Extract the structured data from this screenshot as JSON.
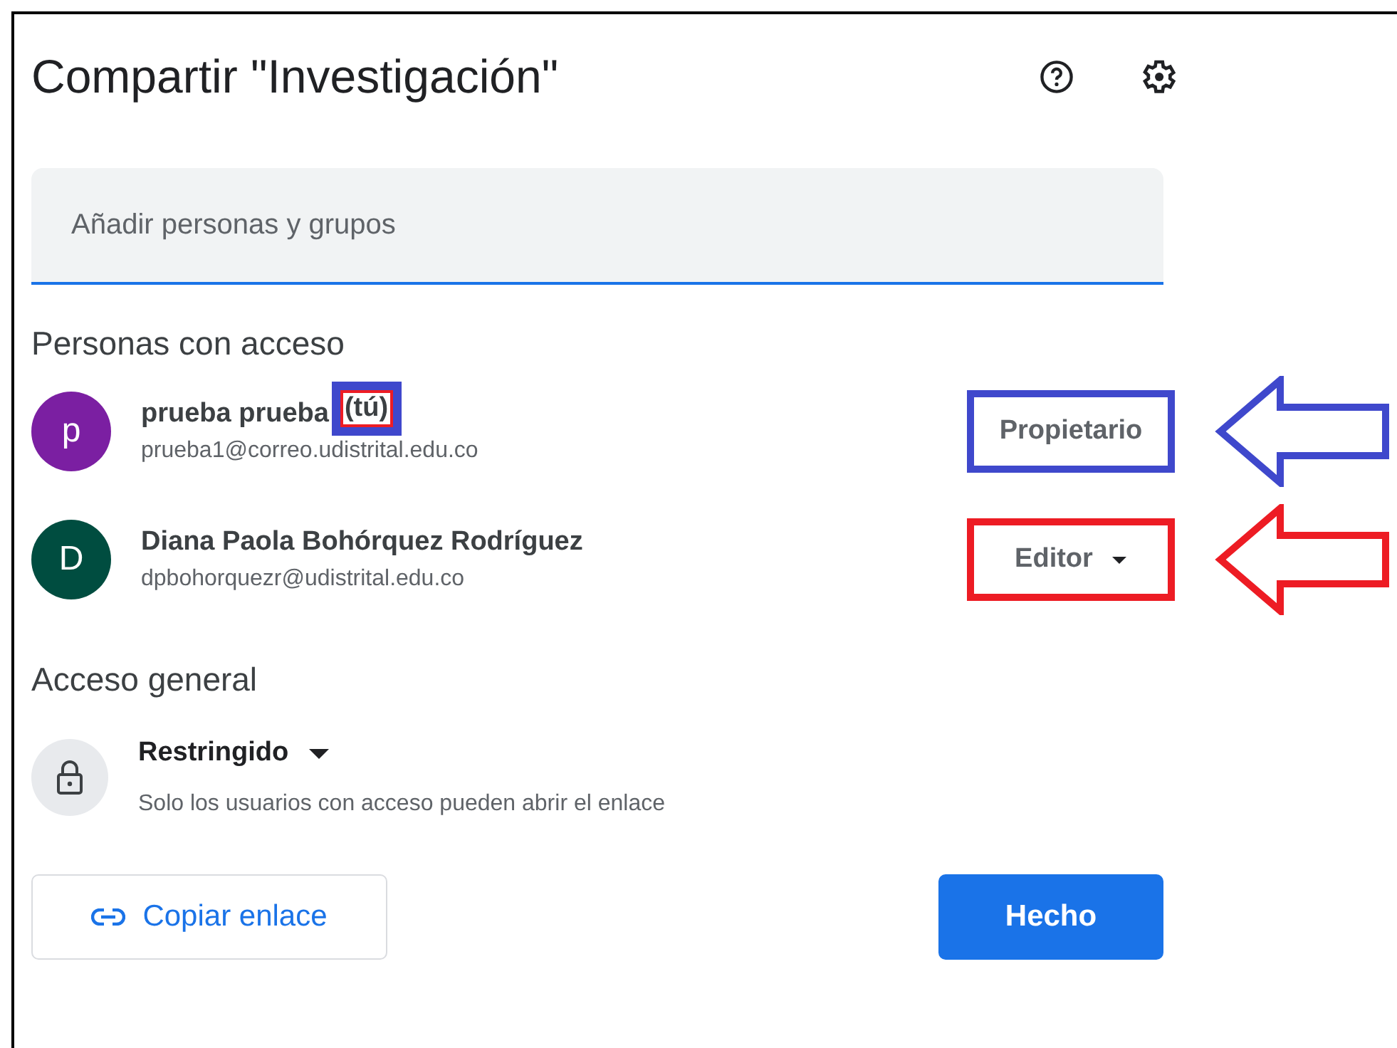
{
  "dialog": {
    "title": "Compartir \"Investigación\"",
    "search": {
      "placeholder": "Añadir personas y grupos"
    },
    "people_heading": "Personas con acceso",
    "people": [
      {
        "initial": "p",
        "color": "#7b1fa2",
        "name": "prueba prueba",
        "you_tag": {
          "text": "(tú)",
          "outlines": [
            {
              "color": "#3f48cc"
            },
            {
              "color": "#ed1c24"
            }
          ]
        },
        "email": "prueba1@correo.udistrital.edu.co",
        "role": "Propietario",
        "role_dropdown": false,
        "annotation": {
          "color": "#3f48cc"
        }
      },
      {
        "initial": "D",
        "color": "#004d40",
        "name": "Diana Paola Bohórquez Rodríguez",
        "email": "dpbohorquezr@udistrital.edu.co",
        "role": "Editor",
        "role_dropdown": true,
        "annotation": {
          "color": "#ed1c24"
        }
      }
    ],
    "general_heading": "Acceso general",
    "general": {
      "access": "Restringido",
      "description": "Solo los usuarios con acceso pueden abrir el enlace"
    },
    "copy_link": "Copiar enlace",
    "done": "Hecho"
  }
}
